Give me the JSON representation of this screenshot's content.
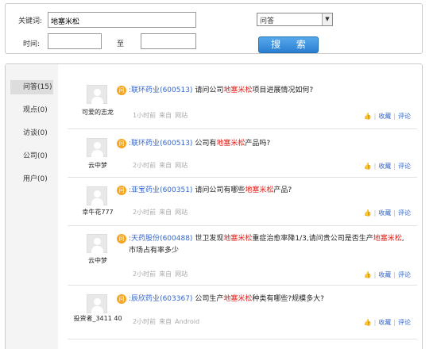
{
  "search": {
    "keyword_label": "关键词:",
    "keyword_value": "地塞米松",
    "time_label": "时间:",
    "to_label": "至",
    "type_value": "问答",
    "search_button": "搜 索"
  },
  "sidebar": {
    "items": [
      {
        "label": "问答(15)",
        "active": true
      },
      {
        "label": "观点(0)"
      },
      {
        "label": "访谈(0)"
      },
      {
        "label": "公司(0)"
      },
      {
        "label": "用户(0)"
      }
    ]
  },
  "actions": {
    "collect": "收藏",
    "comment": "评论"
  },
  "items": [
    {
      "user": "可爱的志龙",
      "colon": ":",
      "company": "联环药业",
      "code": "(600513)",
      "q_before": "请问公司",
      "keyword": "地塞米松",
      "q_after": "项目进展情况如何?",
      "time": "1小时前",
      "from": "来自",
      "source": "网站"
    },
    {
      "user": "云中梦",
      "colon": ":",
      "company": "联环药业",
      "code": "(600513)",
      "q_before": "公司有",
      "keyword": "地塞米松",
      "q_after": "产品吗?",
      "time": "2小时前",
      "from": "来自",
      "source": "网站"
    },
    {
      "user": "幸牛花777",
      "colon": ":",
      "company": "亚宝药业",
      "code": "(600351)",
      "q_before": "请问公司有哪些",
      "keyword": "地塞米松",
      "q_after": "产品?",
      "time": "2小时前",
      "from": "来自",
      "source": "网站"
    },
    {
      "user": "云中梦",
      "colon": ":",
      "company": "天药股份",
      "code": "(600488)",
      "q_before": "世卫发现",
      "keyword": "地塞米松",
      "q_mid": "重症治愈率降1/3,请问贵公司是否生产",
      "keyword2": "地塞米松",
      "q_after": ",",
      "q_line2": "市场占有率多少",
      "time": "2小时前",
      "from": "来自",
      "source": "网站"
    },
    {
      "user": "投资者_3411 40",
      "colon": ":",
      "company": "辰欣药业",
      "code": "(603367)",
      "q_before": "公司生产",
      "keyword": "地塞米松",
      "q_after": "种类有哪些?规模多大?",
      "time": "2小时前",
      "from": "来自",
      "source": "Android"
    }
  ]
}
